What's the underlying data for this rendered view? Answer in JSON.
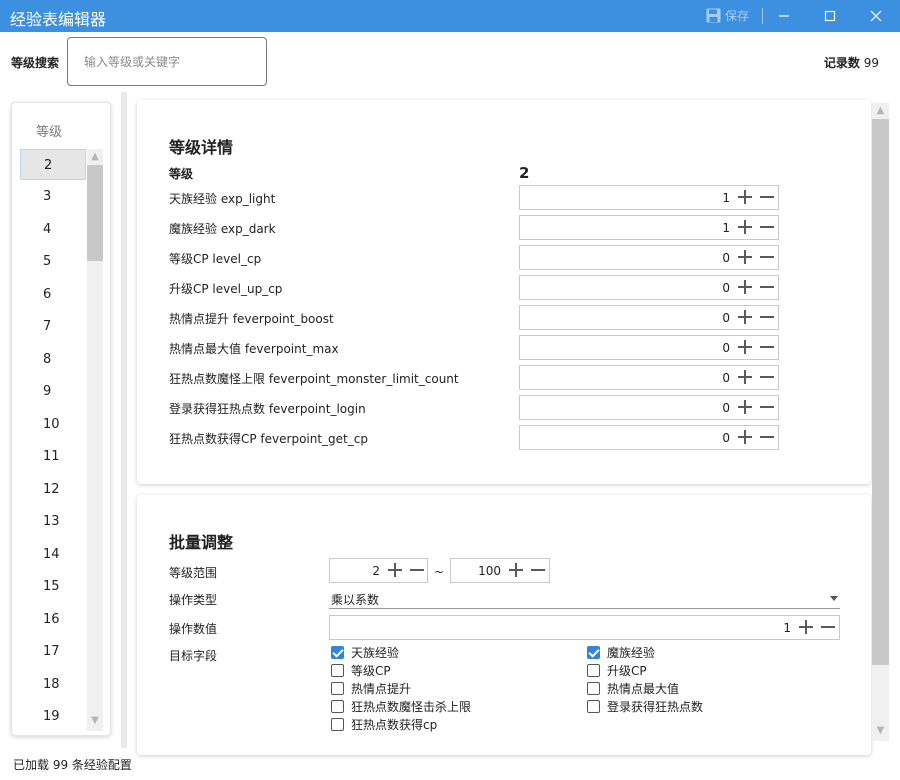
{
  "window": {
    "title": "经验表编辑器",
    "save_label": "保存",
    "save_icon": "save-icon",
    "minimize_icon": "minimize-icon",
    "maximize_icon": "maximize-icon",
    "close_icon": "close-icon",
    "titlebar_color": "#3d8fe0"
  },
  "search": {
    "label": "等级搜索",
    "placeholder": "输入等级或关键字",
    "value": "",
    "record_label": "记录数",
    "record_count": "99"
  },
  "level_list": {
    "header": "等级",
    "selected": "2",
    "items": [
      "2",
      "3",
      "4",
      "5",
      "6",
      "7",
      "8",
      "9",
      "10",
      "11",
      "12",
      "13",
      "14",
      "15",
      "16",
      "17",
      "18",
      "19"
    ]
  },
  "detail": {
    "title": "等级详情",
    "level_label": "等级",
    "level_value": "2",
    "fields": [
      {
        "label": "天族经验 exp_light",
        "value": "1"
      },
      {
        "label": "魔族经验 exp_dark",
        "value": "1"
      },
      {
        "label": "等级CP level_cp",
        "value": "0"
      },
      {
        "label": "升级CP level_up_cp",
        "value": "0"
      },
      {
        "label": "热情点提升 feverpoint_boost",
        "value": "0"
      },
      {
        "label": "热情点最大值 feverpoint_max",
        "value": "0"
      },
      {
        "label": "狂热点数魔怪上限 feverpoint_monster_limit_count",
        "value": "0"
      },
      {
        "label": "登录获得狂热点数 feverpoint_login",
        "value": "0"
      },
      {
        "label": "狂热点数获得CP feverpoint_get_cp",
        "value": "0"
      }
    ]
  },
  "batch": {
    "title": "批量调整",
    "range_label": "等级范围",
    "range_from": "2",
    "range_sep": "~",
    "range_to": "100",
    "op_type_label": "操作类型",
    "op_type_value": "乘以系数",
    "op_value_label": "操作数值",
    "op_value": "1",
    "target_label": "目标字段",
    "targets": [
      {
        "label": "天族经验",
        "checked": true
      },
      {
        "label": "魔族经验",
        "checked": true
      },
      {
        "label": "等级CP",
        "checked": false
      },
      {
        "label": "升级CP",
        "checked": false
      },
      {
        "label": "热情点提升",
        "checked": false
      },
      {
        "label": "热情点最大值",
        "checked": false
      },
      {
        "label": "狂热点数魔怪击杀上限",
        "checked": false
      },
      {
        "label": "登录获得狂热点数",
        "checked": false
      },
      {
        "label": "狂热点数获得cp",
        "checked": false
      }
    ]
  },
  "status": {
    "text": "已加载 99 条经验配置"
  },
  "colors": {
    "accent": "#2f86d6"
  }
}
